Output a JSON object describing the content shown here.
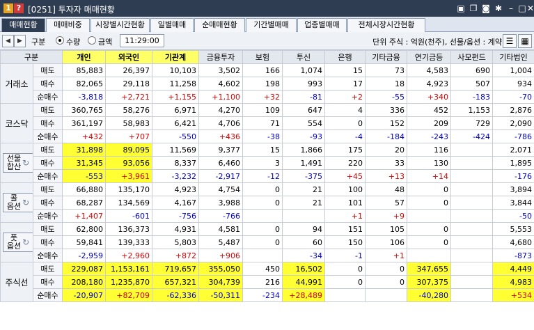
{
  "window": {
    "badge_1": "1",
    "badge_2": "?",
    "title": "[0251] 투자자 매매현황",
    "icons": [
      "link-icon",
      "copy-icon",
      "camera-icon",
      "gear-icon",
      "minimize-icon",
      "maximize-icon",
      "close-icon"
    ]
  },
  "tabs": [
    {
      "label": "매매현황",
      "active": true
    },
    {
      "label": "매매비중",
      "active": false
    },
    {
      "label": "시장별시간현황",
      "active": false
    },
    {
      "label": "일별매매",
      "active": false
    },
    {
      "label": "순매매현황",
      "active": false
    },
    {
      "label": "기간별매매",
      "active": false
    },
    {
      "label": "업종별매매",
      "active": false
    },
    {
      "label": "전체시장시간현황",
      "active": false
    }
  ],
  "toolbar": {
    "category_label": "구분",
    "radio_quantity": "수량",
    "radio_amount": "금액",
    "selected": "수량",
    "time_value": "11:29:00",
    "unit_info": "단위 주식 : 억원(천주), 선물/옵션 : 계약"
  },
  "table": {
    "headers": [
      "구분",
      "개인",
      "외국인",
      "기관계",
      "금융투자",
      "보험",
      "투신",
      "은행",
      "기타금융",
      "연기금등",
      "사모펀드",
      "기타법인"
    ],
    "highlighted_headers": [
      1,
      2,
      3
    ],
    "row_labels": [
      "매도",
      "매수",
      "순매수"
    ],
    "groups": [
      {
        "name": "거래소",
        "has_button": false,
        "rows": [
          [
            "85,883",
            "26,397",
            "10,103",
            "3,502",
            "166",
            "1,074",
            "15",
            "73",
            "4,583",
            "690",
            "1,004"
          ],
          [
            "82,065",
            "29,118",
            "11,258",
            "4,602",
            "198",
            "993",
            "17",
            "18",
            "4,923",
            "507",
            "934"
          ],
          [
            "-3,818",
            "+2,721",
            "+1,155",
            "+1,100",
            "+32",
            "-81",
            "+2",
            "-55",
            "+340",
            "-183",
            "-70"
          ]
        ],
        "yellow": []
      },
      {
        "name": "코스닥",
        "has_button": false,
        "rows": [
          [
            "360,765",
            "58,276",
            "6,971",
            "4,270",
            "109",
            "647",
            "4",
            "336",
            "452",
            "1,153",
            "2,876"
          ],
          [
            "361,197",
            "58,983",
            "6,421",
            "4,706",
            "71",
            "554",
            "0",
            "152",
            "209",
            "729",
            "2,090"
          ],
          [
            "+432",
            "+707",
            "-550",
            "+436",
            "-38",
            "-93",
            "-4",
            "-184",
            "-243",
            "-424",
            "-786"
          ]
        ],
        "yellow": []
      },
      {
        "name": "선물\n합산",
        "has_button": true,
        "rows": [
          [
            "31,898",
            "89,095",
            "11,569",
            "9,377",
            "15",
            "1,866",
            "175",
            "20",
            "116",
            "",
            "2,071"
          ],
          [
            "31,345",
            "93,056",
            "8,337",
            "6,460",
            "3",
            "1,491",
            "220",
            "33",
            "130",
            "",
            "1,895"
          ],
          [
            "-553",
            "+3,961",
            "-3,232",
            "-2,917",
            "-12",
            "-375",
            "+45",
            "+13",
            "+14",
            "",
            "-176"
          ]
        ],
        "yellow": [
          0,
          1
        ]
      },
      {
        "name": "콜\n옵션",
        "has_button": true,
        "rows": [
          [
            "66,880",
            "135,170",
            "4,923",
            "4,754",
            "0",
            "21",
            "100",
            "48",
            "0",
            "",
            "3,894"
          ],
          [
            "68,287",
            "134,569",
            "4,167",
            "3,988",
            "0",
            "21",
            "101",
            "57",
            "0",
            "",
            "3,844"
          ],
          [
            "+1,407",
            "-601",
            "-756",
            "-766",
            "",
            "",
            "+1",
            "+9",
            "",
            "",
            "-50"
          ]
        ],
        "yellow": []
      },
      {
        "name": "풋\n옵션",
        "has_button": true,
        "rows": [
          [
            "62,800",
            "136,373",
            "4,931",
            "4,581",
            "0",
            "94",
            "151",
            "105",
            "0",
            "",
            "5,553"
          ],
          [
            "59,841",
            "139,333",
            "5,803",
            "5,487",
            "0",
            "60",
            "150",
            "106",
            "0",
            "",
            "4,680"
          ],
          [
            "-2,959",
            "+2,960",
            "+872",
            "+906",
            "",
            "-34",
            "-1",
            "+1",
            "",
            "",
            "-873"
          ]
        ],
        "yellow": []
      },
      {
        "name": "주식선",
        "has_button": false,
        "rows": [
          [
            "229,087",
            "1,153,161",
            "719,657",
            "355,050",
            "450",
            "16,502",
            "0",
            "0",
            "347,655",
            "",
            "4,449"
          ],
          [
            "208,180",
            "1,235,870",
            "657,321",
            "304,739",
            "216",
            "44,991",
            "0",
            "0",
            "307,375",
            "",
            "4,983"
          ],
          [
            "-20,907",
            "+82,709",
            "-62,336",
            "-50,311",
            "-234",
            "+28,489",
            "",
            "",
            "-40,280",
            "",
            "+534"
          ]
        ],
        "yellow": [
          0,
          1,
          2,
          3,
          5,
          8,
          10
        ]
      }
    ]
  },
  "colors": {
    "titlebar": "#2f3d52",
    "highlight": "#ffff33",
    "positive": "#d90000",
    "negative": "#0000cc"
  }
}
